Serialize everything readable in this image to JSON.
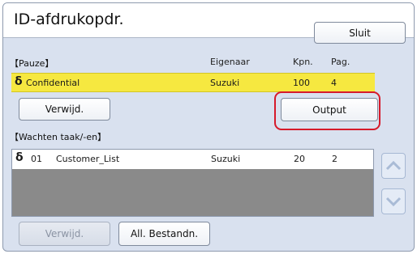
{
  "header": {
    "title": "ID-afdrukopdr.",
    "close_label": "Sluit"
  },
  "paused_section": {
    "label": "【Pauze】",
    "columns": {
      "owner": "Eigenaar",
      "copies": "Kpn.",
      "pages": "Pag."
    },
    "row": {
      "icon": "key-icon",
      "name": "Confidential",
      "owner": "Suzuki",
      "copies": "100",
      "pages": "4"
    },
    "delete_label": "Verwijd.",
    "output_label": "Output"
  },
  "waiting_section": {
    "label": "【Wachten taak/-en】",
    "rows": [
      {
        "icon": "key-icon",
        "number": "01",
        "name": "Customer_List",
        "owner": "Suzuki",
        "copies": "20",
        "pages": "2"
      }
    ],
    "delete_label": "Verwijd.",
    "all_files_label": "All. Bestandn."
  },
  "icons": {
    "key": "δ",
    "up": "chevron-up-icon",
    "down": "chevron-down-icon"
  },
  "colors": {
    "active_row": "#f6e840",
    "highlight": "#d61a2b",
    "panel": "#d9e1ef"
  }
}
